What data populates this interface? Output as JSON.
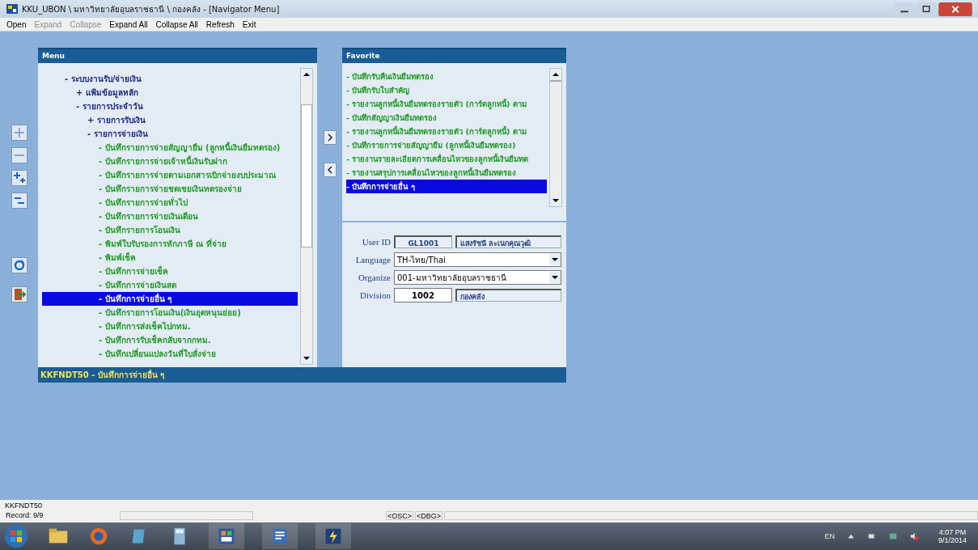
{
  "window": {
    "title": "KKU_UBON \\ มหาวิทยาลัยอุบลราชธานี \\ กองคลัง - [Navigator Menu]"
  },
  "menu_bar": [
    {
      "label": "Open",
      "disabled": false
    },
    {
      "label": "Expand",
      "disabled": true
    },
    {
      "label": "Collapse",
      "disabled": true
    },
    {
      "label": "Expand All",
      "disabled": false
    },
    {
      "label": "Collapse All",
      "disabled": false
    },
    {
      "label": "Refresh",
      "disabled": false
    },
    {
      "label": "Exit",
      "disabled": false
    }
  ],
  "menu": {
    "title": "Menu",
    "items": [
      {
        "label": "- ระบบงานรับ/จ่ายเงิน",
        "kind": "folder",
        "selected": false,
        "children": [
          {
            "label": "+ แฟ้มข้อมูลหลัก",
            "kind": "folder",
            "selected": false
          },
          {
            "label": "- รายการประจำวัน",
            "kind": "folder",
            "selected": false,
            "children": [
              {
                "label": "+ รายการรับเงิน",
                "kind": "folder",
                "selected": false
              },
              {
                "label": "- รายการจ่ายเงิน",
                "kind": "folder",
                "selected": false,
                "children": [
                  {
                    "label": "- บันทึกรายการจ่ายสัญญายืม (ลูกหนี้เงินยืมทดรอง)",
                    "kind": "item",
                    "selected": false
                  },
                  {
                    "label": "- บันทึกรายการจ่ายเจ้าหนี้เงินรับฝาก",
                    "kind": "item",
                    "selected": false
                  },
                  {
                    "label": "- บันทึกรายการจ่ายตามเอกสารเบิกจ่ายงบประมาณ",
                    "kind": "item",
                    "selected": false
                  },
                  {
                    "label": "- บันทึกรายการจ่ายชดเชยเงินทดรองจ่าย",
                    "kind": "item",
                    "selected": false
                  },
                  {
                    "label": "- บันทึกรายการจ่ายทั่วไป",
                    "kind": "item",
                    "selected": false
                  },
                  {
                    "label": "- บันทึกรายการจ่ายเงินเดือน",
                    "kind": "item",
                    "selected": false
                  },
                  {
                    "label": "- บันทึกรายการโอนเงิน",
                    "kind": "item",
                    "selected": false
                  },
                  {
                    "label": "- พิมพ์ใบรับรองการหักภาษี ณ ที่จ่าย",
                    "kind": "item",
                    "selected": false
                  },
                  {
                    "label": "- พิมพ์เช็ค",
                    "kind": "item",
                    "selected": false
                  },
                  {
                    "label": "- บันทึกการจ่ายเช็ค",
                    "kind": "item",
                    "selected": false
                  },
                  {
                    "label": "- บันทึกการจ่ายเงินสด",
                    "kind": "item",
                    "selected": false
                  },
                  {
                    "label": "- บันทึกการจ่ายอื่น ๆ",
                    "kind": "item",
                    "selected": true
                  },
                  {
                    "label": "- บันทึกรายการโอนเงิน(เงินอุดหนุนย่อย)",
                    "kind": "item",
                    "selected": false
                  },
                  {
                    "label": "- บันทึกการส่งเช็คไปกทม.",
                    "kind": "item",
                    "selected": false
                  },
                  {
                    "label": "- บันทึกการรับเช็คกลับจากกทม.",
                    "kind": "item",
                    "selected": false
                  },
                  {
                    "label": "- บันทึกเปลี่ยนแปลงวันที่ใบสั่งจ่าย",
                    "kind": "item",
                    "selected": false
                  }
                ]
              }
            ]
          }
        ]
      }
    ],
    "status": "KKFNDT50 - บันทึกการจ่ายอื่น ๆ"
  },
  "favorite": {
    "title": "Favorite",
    "items": [
      {
        "label": "- บันทึกรับคืนเงินยืมทดรอง",
        "selected": false
      },
      {
        "label": "- บันทึกรับใบสำคัญ",
        "selected": false
      },
      {
        "label": "- รายงานลูกหนี้เงินยืมทดรองรายตัว (การ์ดลูกหนี้) ตาม",
        "selected": false
      },
      {
        "label": "- บันทึกสัญญาเงินยืมทดรอง",
        "selected": false
      },
      {
        "label": "- รายงานลูกหนี้เงินยืมทดรองรายตัว (การ์ดลูกหนี้) ตาม",
        "selected": false
      },
      {
        "label": "- บันทึกรายการจ่ายสัญญายืม (ลูกหนี้เงินยืมทดรอง)",
        "selected": false
      },
      {
        "label": "- รายงานรายละเอียดการเคลื่อนไหวของลูกหนี้เงินยืมทด",
        "selected": false
      },
      {
        "label": "- รายงานสรุปการเคลื่อนไหวของลูกหนี้เงินยืมทดรอง",
        "selected": false
      },
      {
        "label": "- บันทึกการจ่ายอื่น ๆ",
        "selected": true
      }
    ]
  },
  "user": {
    "user_id_label": "User ID",
    "user_id": "GL1001",
    "user_name": "แสงรัชนี ละเนกคุณวุฒิ",
    "language_label": "Language",
    "language": "TH-ไทย/Thai",
    "organize_label": "Organize",
    "organize": "001-มหาวิทยาลัยอุบลราชธานี",
    "division_label": "Division",
    "division": "1002",
    "division_name": "กองคลัง"
  },
  "status_bar": {
    "form": "KKFNDT50",
    "record": "Record: 9/9",
    "osc": "<OSC>",
    "dbg": "<DBG>"
  },
  "taskbar": {
    "language": "EN",
    "time": "4:07 PM",
    "date": "9/1/2014"
  }
}
